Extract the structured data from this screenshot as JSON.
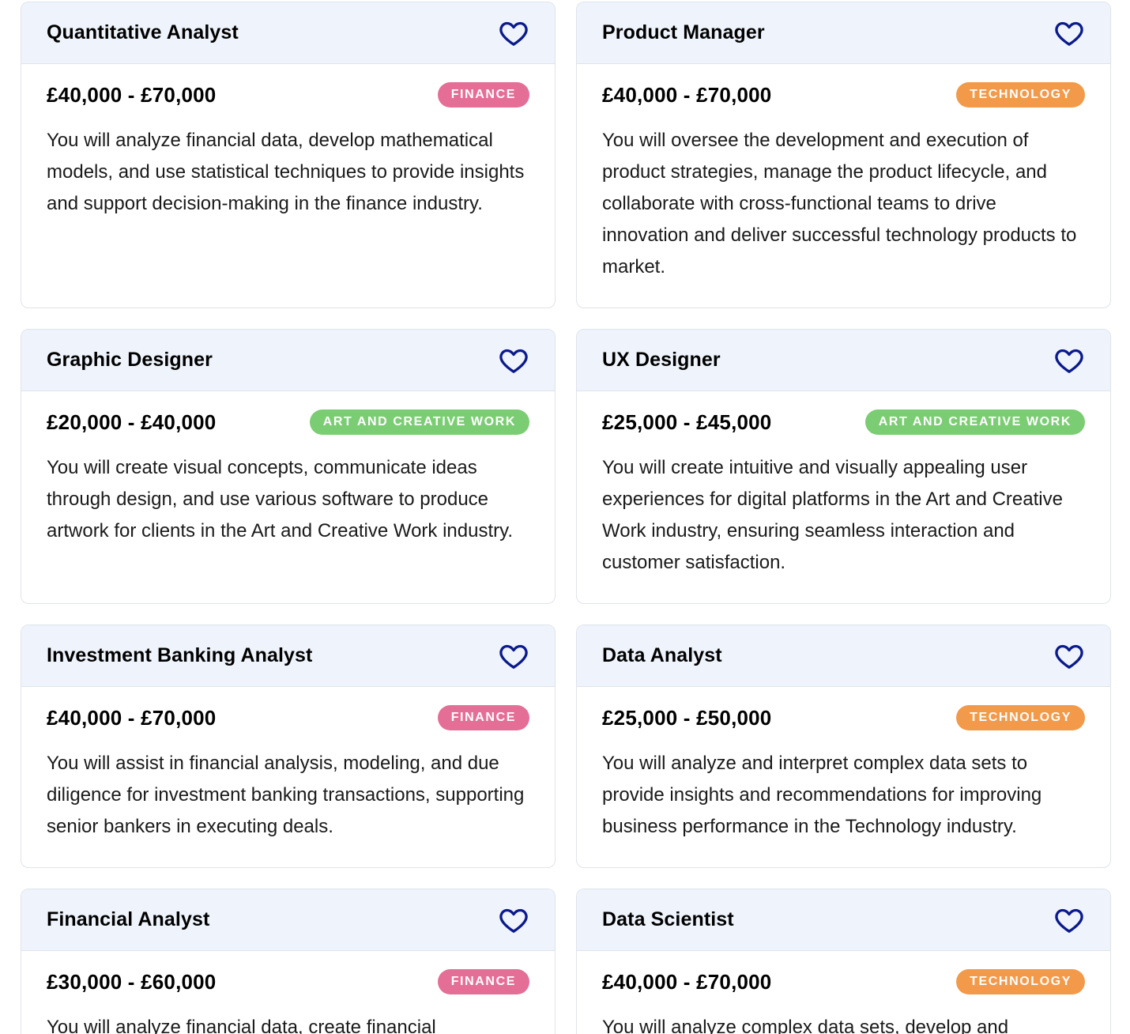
{
  "colors": {
    "finance": "#e46e96",
    "technology": "#f29a4a",
    "art": "#7bcd73",
    "heart": "#0b1a8c"
  },
  "jobs": [
    {
      "title": "Quantitative Analyst",
      "salary": "£40,000 - £70,000",
      "category": "FINANCE",
      "category_key": "finance",
      "description": "You will analyze financial data, develop mathematical models, and use statistical techniques to provide insights and support decision-making in the finance industry.",
      "favorite_icon": "heart-outline-icon"
    },
    {
      "title": "Product Manager",
      "salary": "£40,000 - £70,000",
      "category": "TECHNOLOGY",
      "category_key": "technology",
      "description": "You will oversee the development and execution of product strategies, manage the product lifecycle, and collaborate with cross-functional teams to drive innovation and deliver successful technology products to market.",
      "favorite_icon": "heart-outline-icon"
    },
    {
      "title": "Graphic Designer",
      "salary": "£20,000 - £40,000",
      "category": "ART AND CREATIVE WORK",
      "category_key": "art",
      "description": "You will create visual concepts, communicate ideas through design, and use various software to produce artwork for clients in the Art and Creative Work industry.",
      "favorite_icon": "heart-outline-icon"
    },
    {
      "title": "UX Designer",
      "salary": "£25,000 - £45,000",
      "category": "ART AND CREATIVE WORK",
      "category_key": "art",
      "description": "You will create intuitive and visually appealing user experiences for digital platforms in the Art and Creative Work industry, ensuring seamless interaction and customer satisfaction.",
      "favorite_icon": "heart-outline-icon"
    },
    {
      "title": "Investment Banking Analyst",
      "salary": "£40,000 - £70,000",
      "category": "FINANCE",
      "category_key": "finance",
      "description": "You will assist in financial analysis, modeling, and due diligence for investment banking transactions, supporting senior bankers in executing deals.",
      "favorite_icon": "heart-outline-icon"
    },
    {
      "title": "Data Analyst",
      "salary": "£25,000 - £50,000",
      "category": "TECHNOLOGY",
      "category_key": "technology",
      "description": "You will analyze and interpret complex data sets to provide insights and recommendations for improving business performance in the Technology industry.",
      "favorite_icon": "heart-outline-icon"
    },
    {
      "title": "Financial Analyst",
      "salary": "£30,000 - £60,000",
      "category": "FINANCE",
      "category_key": "finance",
      "description": "You will analyze financial data, create financial",
      "favorite_icon": "heart-outline-icon"
    },
    {
      "title": "Data Scientist",
      "salary": "£40,000 - £70,000",
      "category": "TECHNOLOGY",
      "category_key": "technology",
      "description": "You will analyze complex data sets, develop and",
      "favorite_icon": "heart-outline-icon"
    }
  ]
}
